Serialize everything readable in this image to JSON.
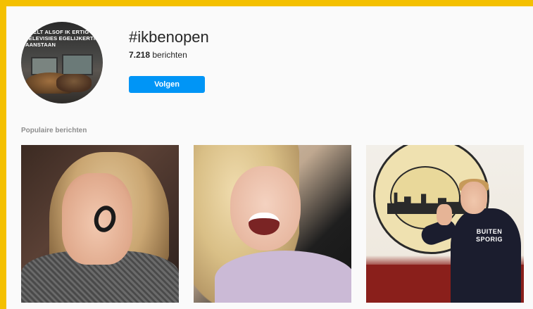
{
  "header": {
    "hashtag": "#ikbenopen",
    "post_count_value": "7.218",
    "post_count_label": "berichten",
    "follow_label": "Volgen",
    "avatar_caption": "VOELT ALSOF IK ERTIG TELEVISIES EGELIJKERTIJD AANSTAAN"
  },
  "section": {
    "title": "Populaire berichten"
  },
  "posts": [
    {
      "subject": "woman-hand-with-circle-mark"
    },
    {
      "subject": "smiling-blonde-woman"
    },
    {
      "subject": "man-with-raised-hand-by-emblem",
      "shirt_text": "BUITEN SPORIG"
    }
  ],
  "colors": {
    "frame_accent": "#f4c000",
    "button_blue": "#0095f6",
    "background": "#fafafa"
  }
}
